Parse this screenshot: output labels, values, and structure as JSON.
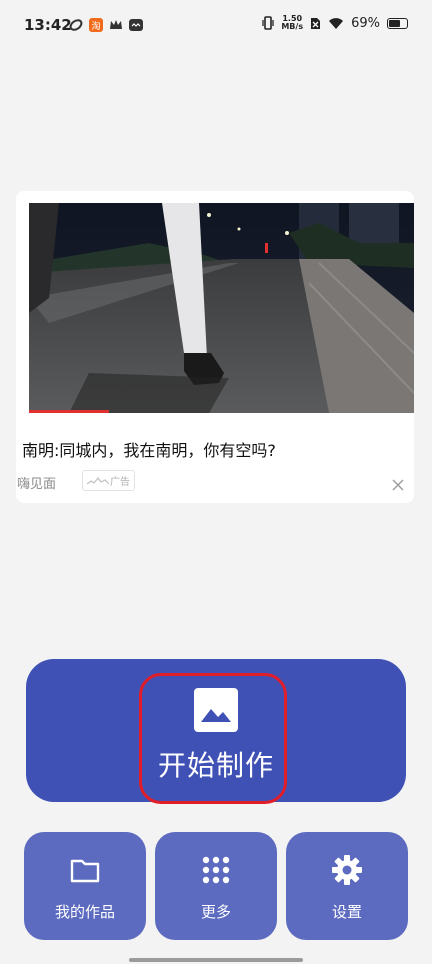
{
  "status_bar": {
    "time": "13:42",
    "net_speed_value": "1.50",
    "net_speed_unit": "MB/s",
    "battery_percent": "69%",
    "battery_level": 0.69
  },
  "ad": {
    "title": "南明:同城内，我在南明，你有空吗?",
    "source": "嗨见面",
    "badge": "广告"
  },
  "main_action": {
    "label": "开始制作",
    "icon": "image-icon"
  },
  "tiles": [
    {
      "label": "我的作品",
      "icon": "folder-icon"
    },
    {
      "label": "更多",
      "icon": "grid-dots-icon"
    },
    {
      "label": "设置",
      "icon": "gear-icon"
    }
  ],
  "colors": {
    "primary": "#3f51b5",
    "tile": "#5c6bc0",
    "highlight": "#e11d2a",
    "background": "#f3f3f3"
  }
}
